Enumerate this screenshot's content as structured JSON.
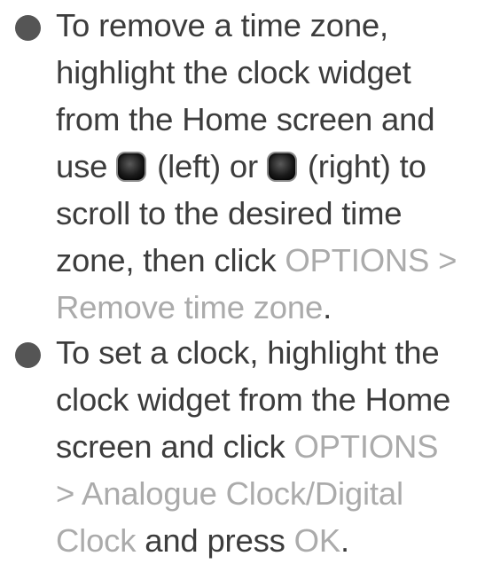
{
  "items": [
    {
      "lines": [
        "To remove a time zone,",
        "highlight the clock widget",
        "from the Home screen and",
        {
          "before": "use ",
          "key1": "left-key-icon",
          "mid1": " (left) or ",
          "key2": "right-key-icon",
          "mid2": " (right) to"
        },
        "scroll to the desired time",
        {
          "plain": "zone, then click ",
          "hl": "OPTIONS >"
        },
        {
          "hl": "Remove time zone",
          "plain": "."
        }
      ]
    },
    {
      "lines": [
        "To set a clock, highlight the",
        "clock widget from the Home",
        {
          "plain": "screen and click ",
          "hl": "OPTIONS"
        },
        {
          "hl": "> Analogue Clock/Digital"
        },
        {
          "hl": "Clock",
          "plain": " and press ",
          "hl2": "OK",
          "plain2": "."
        }
      ]
    }
  ]
}
